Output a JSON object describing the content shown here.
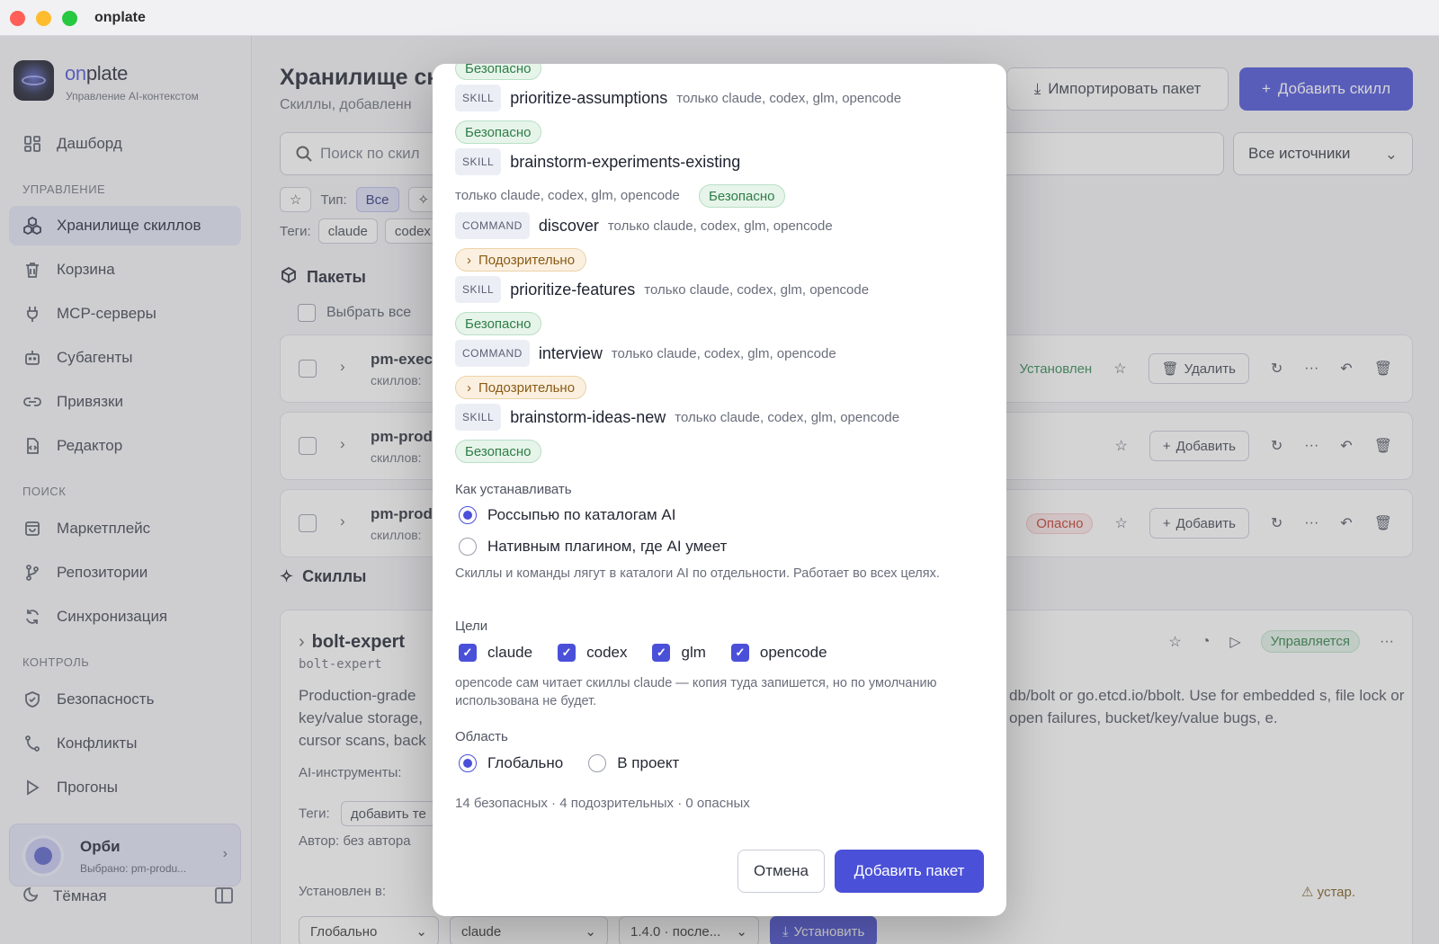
{
  "window": {
    "title": "onplate"
  },
  "sidebar": {
    "brand_prefix": "on",
    "brand_rest": "plate",
    "brand_sub": "Управление AI-контекстом",
    "dashboard": "Дашборд",
    "section_manage": "УПРАВЛЕНИЕ",
    "manage_items": [
      "Хранилище скиллов",
      "Корзина",
      "MCP-серверы",
      "Субагенты",
      "Привязки",
      "Редактор"
    ],
    "section_search": "ПОИСК",
    "search_items": [
      "Маркетплейс",
      "Репозитории",
      "Синхронизация"
    ],
    "section_control": "КОНТРОЛЬ",
    "control_items": [
      "Безопасность",
      "Конфликты",
      "Прогоны"
    ],
    "user_name": "Орби",
    "user_sub": "Выбрано: pm-produ...",
    "theme": "Тёмная"
  },
  "main": {
    "title": "Хранилище ск",
    "subtitle": "Скиллы, добавленн",
    "import_btn": "Импортировать пакет",
    "add_skill_btn": "Добавить скилл",
    "search_placeholder": "Поиск по скил",
    "sources": "Все источники",
    "type_label": "Тип:",
    "type_all": "Все",
    "tags_label": "Теги:",
    "tags": [
      "claude",
      "codex"
    ],
    "packages_title": "Пакеты",
    "select_all": "Выбрать все",
    "packages": [
      {
        "name": "pm-exec",
        "count": "скиллов:",
        "status": "Установлен",
        "action": "Удалить"
      },
      {
        "name": "pm-prod",
        "count": "скиллов:",
        "status": "",
        "action": "Добавить"
      },
      {
        "name": "pm-prod",
        "count": "скиллов:",
        "status": "Опасно",
        "action": "Добавить"
      }
    ],
    "skills_title": "Скиллы",
    "skill": {
      "name": "bolt-expert",
      "slug": "bolt-expert",
      "desc_left": "Production-grade key/value storage, cursor scans, back",
      "desc_right": "db/bolt or go.etcd.io/bbolt. Use for embedded s, file lock or open failures, bucket/key/value bugs, e.",
      "managed": "Управляется",
      "ai_tools": "AI-инструменты:",
      "tags": "Теги:",
      "tags_placeholder": "добавить те",
      "author": "Автор: без автора",
      "installed_in": "Установлен в:",
      "outdated": "⚠ устар.",
      "scope": "Глобально",
      "target": "claude",
      "version": "1.4.0 · после...",
      "install": "Установить"
    }
  },
  "modal": {
    "top_badge": "Безопасно",
    "items": [
      {
        "kind": "SKILL",
        "name": "prioritize-assumptions",
        "scope": "только claude, codex, glm, opencode",
        "badge": "Безопасно",
        "badge_type": "safe"
      },
      {
        "kind": "SKILL",
        "name": "brainstorm-experiments-existing",
        "scope": "только claude, codex, glm, opencode",
        "badge": "Безопасно",
        "badge_type": "safe"
      },
      {
        "kind": "COMMAND",
        "name": "discover",
        "scope": "только claude, codex, glm, opencode",
        "badge": "Подозрительно",
        "badge_type": "suspicious"
      },
      {
        "kind": "SKILL",
        "name": "prioritize-features",
        "scope": "только claude, codex, glm, opencode",
        "badge": "Безопасно",
        "badge_type": "safe"
      },
      {
        "kind": "COMMAND",
        "name": "interview",
        "scope": "только claude, codex, glm, opencode",
        "badge": "Подозрительно",
        "badge_type": "suspicious"
      },
      {
        "kind": "SKILL",
        "name": "brainstorm-ideas-new",
        "scope": "только claude, codex, glm, opencode",
        "badge": "Безопасно",
        "badge_type": "safe"
      }
    ],
    "install_label": "Как устанавливать",
    "install_options": [
      "Россыпью по каталогам AI",
      "Нативным плагином, где AI умеет"
    ],
    "install_selected": 0,
    "install_hint": "Скиллы и команды лягут в каталоги AI по отдельности. Работает во всех целях.",
    "targets_label": "Цели",
    "targets": [
      "claude",
      "codex",
      "glm",
      "opencode"
    ],
    "targets_hint": "opencode сам читает скиллы claude — копия туда запишется, но по умолчанию использована не будет.",
    "scope_label": "Область",
    "scope_options": [
      "Глобально",
      "В проект"
    ],
    "scope_selected": 0,
    "summary": "14 безопасных · 4 подозрительных · 0 опасных",
    "cancel": "Отмена",
    "submit": "Добавить пакет"
  }
}
